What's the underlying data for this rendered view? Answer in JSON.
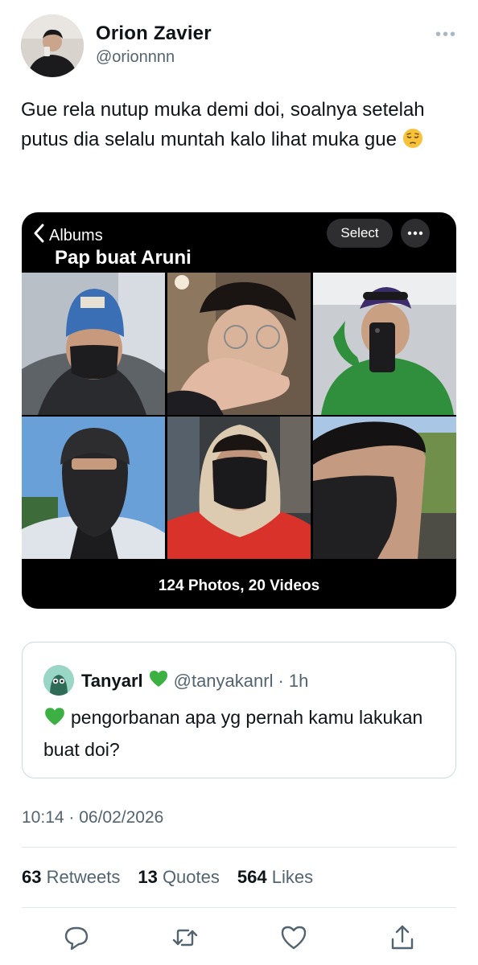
{
  "tweet": {
    "display_name": "Orion Zavier",
    "handle": "@orionnnn",
    "text": "Gue rela nutup muka demi doi, soalnya setelah putus dia selalu muntah kalo lihat muka gue",
    "emoji": "pensive-face",
    "timestamp": "10:14 · 06/02/2026"
  },
  "media": {
    "back_label": "Albums",
    "album_title": "Pap buat Aruni",
    "select_label": "Select",
    "count_label": "124 Photos, 20 Videos",
    "photo_count": 6
  },
  "quote": {
    "display_name": "Tanyarl",
    "handle": "@tanyakanrl",
    "time": "· 1h",
    "text": "pengorbanan apa yg pernah kamu lakukan buat doi?",
    "badge_icon": "green-heart-icon"
  },
  "stats": {
    "retweets_count": "63",
    "retweets_label": "Retweets",
    "quotes_count": "13",
    "quotes_label": "Quotes",
    "likes_count": "564",
    "likes_label": "Likes"
  },
  "colors": {
    "text": "#0f1419",
    "muted": "#536471",
    "border": "#cfd9de",
    "green_heart": "#3cb043"
  }
}
